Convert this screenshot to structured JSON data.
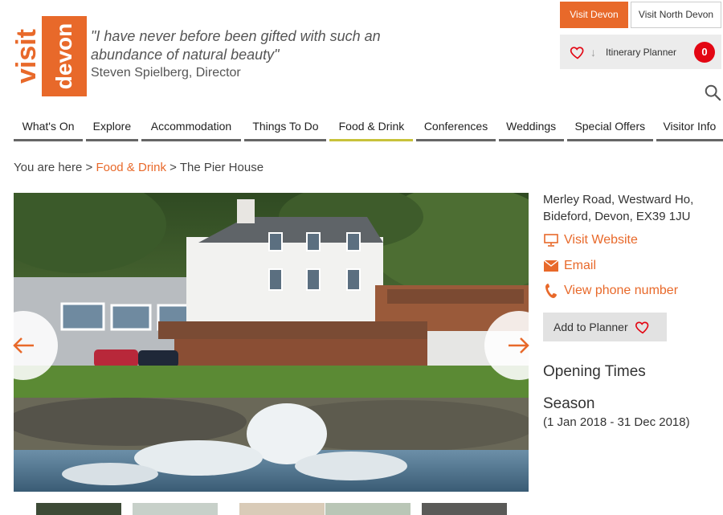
{
  "header": {
    "logo_top": "visit",
    "logo_bottom": "devon",
    "quote": "\"I have never before been gifted with such an abundance of natural beauty\"",
    "quote_author": "Steven Spielberg, Director",
    "btn_visit_devon": "Visit Devon",
    "btn_visit_north_devon": "Visit North Devon",
    "itinerary_label": "Itinerary Planner",
    "itinerary_count": "0"
  },
  "nav": {
    "items": [
      "What's On",
      "Explore",
      "Accommodation",
      "Things To Do",
      "Food & Drink",
      "Conferences",
      "Weddings",
      "Special Offers",
      "Visitor Info"
    ],
    "active": "Food & Drink"
  },
  "breadcrumb": {
    "prefix": "You are here > ",
    "link": "Food & Drink",
    "current": " > The Pier House"
  },
  "sidebar": {
    "address_line1": "Merley Road, Westward Ho,",
    "address_line2": "Bideford, Devon, EX39 1JU",
    "website": "Visit Website",
    "email": "Email",
    "phone": "View phone number",
    "add_planner": "Add to Planner",
    "opening_times": "Opening Times",
    "season": "Season",
    "season_dates": "(1 Jan 2018 - 31 Dec 2018)"
  },
  "colors": {
    "accent": "#e8692a",
    "badge": "#e30613",
    "nav_active_underline": "#c8c23a"
  }
}
